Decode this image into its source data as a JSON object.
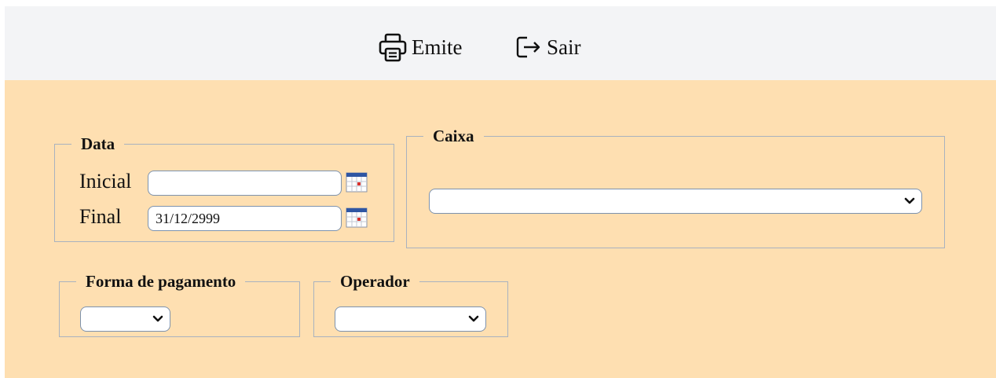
{
  "toolbar": {
    "emite_label": "Emite",
    "emite_icon": "printer-icon",
    "sair_label": "Sair",
    "sair_icon": "exit-icon"
  },
  "data_group": {
    "legend": "Data",
    "inicial_label": "Inicial",
    "inicial_value": "",
    "final_label": "Final",
    "final_value": "31/12/2999",
    "calendar_icon": "calendar-icon"
  },
  "caixa_group": {
    "legend": "Caixa",
    "selected": ""
  },
  "forma_group": {
    "legend": "Forma de pagamento",
    "selected": ""
  },
  "operador_group": {
    "legend": "Operador",
    "selected": ""
  },
  "colors": {
    "toolbar_bg": "#f3f4f6",
    "form_bg": "#fedfb1",
    "border": "#a9b2bf",
    "input_border": "#7d92ad"
  }
}
